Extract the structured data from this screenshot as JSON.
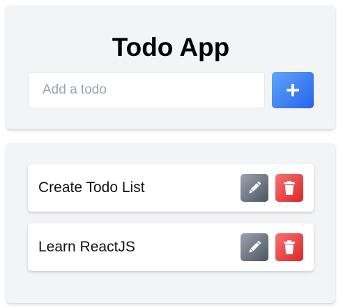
{
  "header": {
    "title": "Todo App",
    "input": {
      "placeholder": "Add a todo",
      "value": ""
    },
    "add_button": {
      "icon": "plus-icon",
      "color": "#3b82f6"
    }
  },
  "todos": [
    {
      "text": "Create Todo List",
      "edit_icon": "pencil-icon",
      "delete_icon": "trash-icon"
    },
    {
      "text": "Learn ReactJS",
      "edit_icon": "pencil-icon",
      "delete_icon": "trash-icon"
    }
  ],
  "colors": {
    "card_background": "#f3f4f6",
    "accent_blue": "#3b82f6",
    "edit_gray": "#6b7280",
    "delete_red": "#ef4444"
  }
}
